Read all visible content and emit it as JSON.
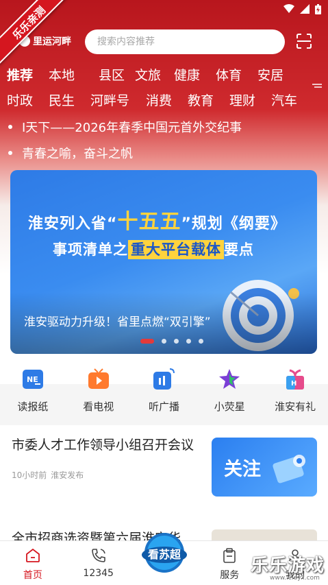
{
  "brand": {
    "corner_ribbon": "乐乐亲测",
    "logo_text": "里运河畔"
  },
  "search": {
    "placeholder": "搜索内容推荐"
  },
  "channels": {
    "row1": [
      "推荐",
      "本地",
      "县区",
      "文旅",
      "健康",
      "体育",
      "安居"
    ],
    "row2": [
      "时政",
      "民生",
      "河畔号",
      "消费",
      "教育",
      "理财",
      "汽车"
    ]
  },
  "ticker": [
    "I天下——2026年春季中国元首外交纪事",
    "青春之喻，奋斗之帆"
  ],
  "banner": {
    "line1_prefix": "淮安列入省“",
    "line1_big": "十五五",
    "line1_suffix": "”规划《纲要》",
    "line2_prefix": "事项清单之",
    "line2_highlight": "重大平台载体",
    "line2_suffix": "要点",
    "caption": "淮安驱动力升级！省里点燃“双引擎”",
    "slide_count": 5,
    "active_slide": 1
  },
  "services": [
    {
      "label": "读报纸",
      "icon": "newspaper-icon"
    },
    {
      "label": "看电视",
      "icon": "tv-icon"
    },
    {
      "label": "听广播",
      "icon": "radio-icon"
    },
    {
      "label": "小荧星",
      "icon": "star-icon"
    },
    {
      "label": "淮安有礼",
      "icon": "gift-icon"
    }
  ],
  "feed": {
    "article1": {
      "title": "市委人才工作领导小组召开会议",
      "time": "10小时前",
      "source": "淮安发布"
    },
    "follow_card": {
      "text": "关注"
    },
    "article2": {
      "title": "全市招商选资暨第六届淮安华"
    }
  },
  "tabbar": [
    {
      "label": "首页",
      "icon": "home-icon",
      "active": true
    },
    {
      "label": "12345",
      "icon": "phone-icon",
      "active": false
    },
    {
      "label": "",
      "icon": "看苏超-badge",
      "active": false
    },
    {
      "label": "服务",
      "icon": "service-icon",
      "active": false
    },
    {
      "label": "我的",
      "icon": "user-icon",
      "active": false
    }
  ],
  "center_badge": {
    "text": "看苏超"
  },
  "watermark": {
    "text": "乐乐游戏",
    "sub": "www.leleyx.com"
  },
  "colors": {
    "brand_red": "#d5161f",
    "banner_blue": "#2e7be6",
    "highlight_yellow": "#ffd33d"
  }
}
